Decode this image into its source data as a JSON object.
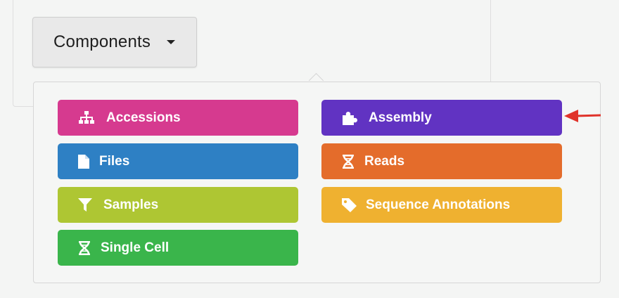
{
  "toggle": {
    "label": "Components",
    "caret": "caret-down-icon"
  },
  "menu": {
    "items": [
      {
        "label": "Accessions",
        "icon": "sitemap-icon",
        "color": "#d63a8f"
      },
      {
        "label": "Files",
        "icon": "file-icon",
        "color": "#2e80c4"
      },
      {
        "label": "Samples",
        "icon": "filter-icon",
        "color": "#aec633"
      },
      {
        "label": "Single Cell",
        "icon": "dna-icon",
        "color": "#3ab54b"
      },
      {
        "label": "Assembly",
        "icon": "puzzle-piece-icon",
        "color": "#6133c2"
      },
      {
        "label": "Reads",
        "icon": "dna-icon",
        "color": "#e46c2b"
      },
      {
        "label": "Sequence Annotations",
        "icon": "tag-icon",
        "color": "#efb130"
      }
    ]
  },
  "annotation": {
    "arrow_color": "#e0332a"
  }
}
